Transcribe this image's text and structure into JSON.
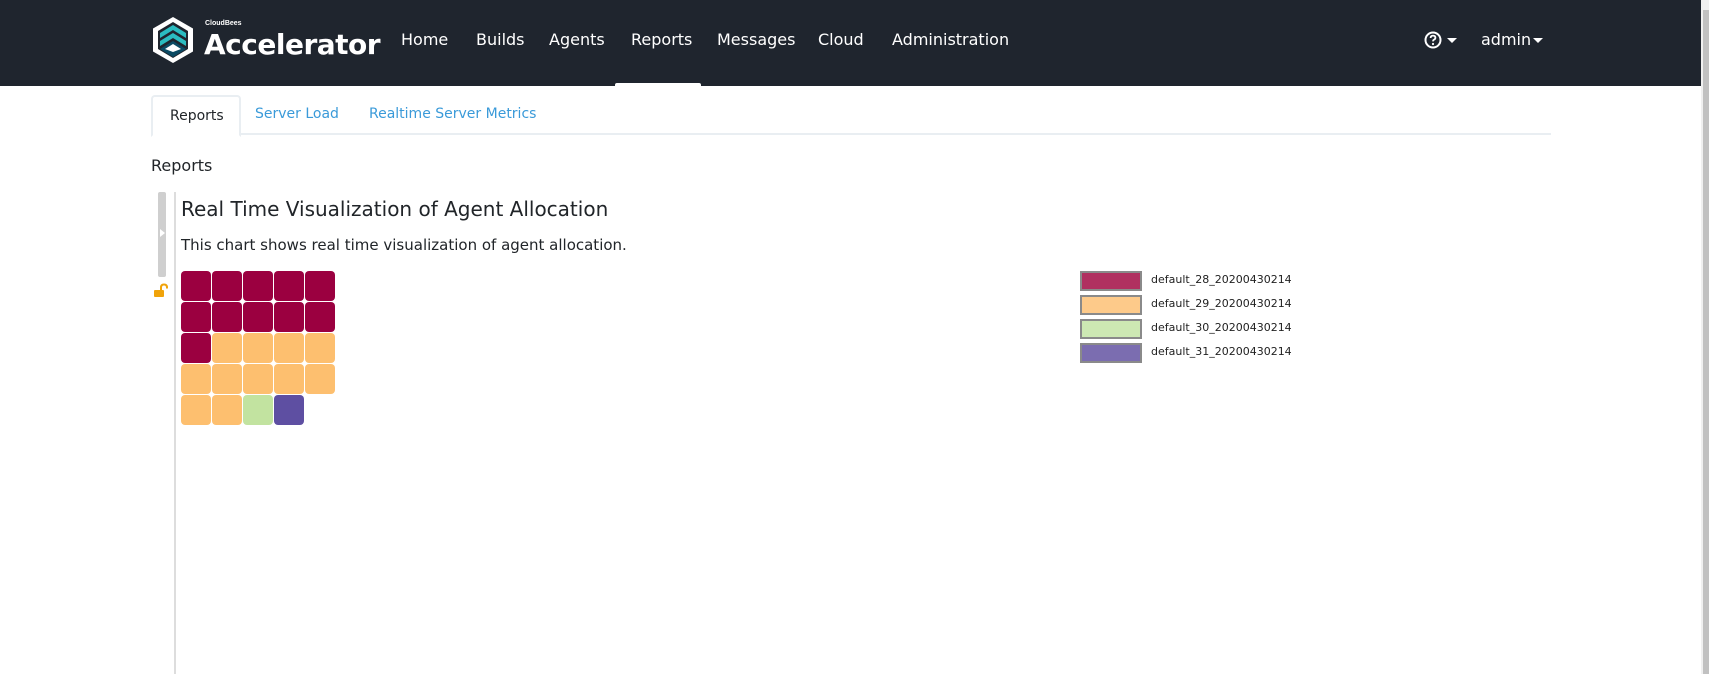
{
  "app": {
    "brand_small": "CloudBees",
    "brand_name": "Accelerator",
    "logo_icon": "cloudbees-hexagon-logo"
  },
  "nav": {
    "items": [
      {
        "label": "Home"
      },
      {
        "label": "Builds"
      },
      {
        "label": "Agents"
      },
      {
        "label": "Reports",
        "active": true
      },
      {
        "label": "Messages"
      },
      {
        "label": "Cloud"
      },
      {
        "label": "Administration"
      }
    ],
    "help_icon": "question-circle-icon",
    "user": "admin"
  },
  "tabs": [
    {
      "label": "Reports",
      "active": true
    },
    {
      "label": "Server Load"
    },
    {
      "label": "Realtime Server Metrics"
    }
  ],
  "page": {
    "section_title": "Reports",
    "card_title": "Real Time Visualization of Agent Allocation",
    "card_description": "This chart shows real time visualization of agent allocation."
  },
  "colors": {
    "navbar_bg": "#1f252e",
    "tab_link": "#3a9ad9",
    "lock": "#f0a30a"
  },
  "chart_data": {
    "type": "waffle",
    "title": "Real Time Visualization of Agent Allocation",
    "columns": 5,
    "series": [
      {
        "name": "default_28_20200430214",
        "count": 11,
        "color": "#9b0040",
        "legend_color": "#b03060"
      },
      {
        "name": "default_29_20200430214",
        "count": 11,
        "color": "#fdbf6f",
        "legend_color": "#fdca8a"
      },
      {
        "name": "default_30_20200430214",
        "count": 1,
        "color": "#c2e3a0",
        "legend_color": "#cde8b3"
      },
      {
        "name": "default_31_20200430214",
        "count": 1,
        "color": "#5e4fa2",
        "legend_color": "#7b6db0"
      }
    ],
    "legend_position": "right"
  }
}
